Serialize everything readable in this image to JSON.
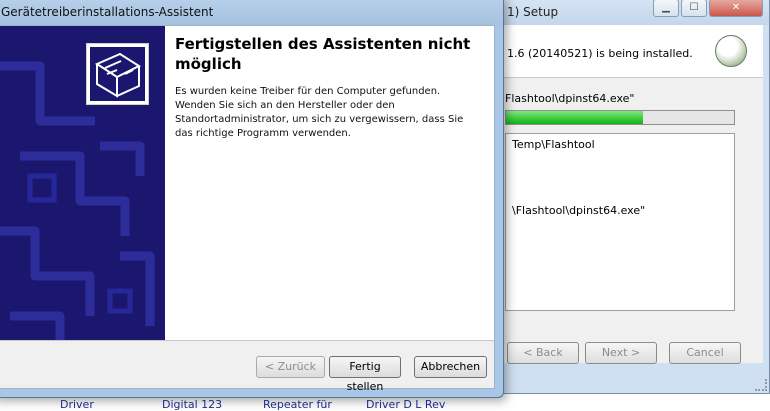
{
  "setup_window": {
    "title": "1) Setup",
    "header_text": "1.6 (20140521) is being installed.",
    "status_text": "Flashtool\\dpinst64.exe\"",
    "progress": 0.6,
    "log_lines": [
      "Temp\\Flashtool",
      "\\Flashtool\\dpinst64.exe\""
    ],
    "buttons": {
      "back": "< Back",
      "next": "Next >",
      "cancel": "Cancel"
    }
  },
  "wizard": {
    "title": "Gerätetreiberinstallations-Assistent",
    "heading": "Fertigstellen des Assistenten nicht möglich",
    "message": "Es wurden keine Treiber für den Computer gefunden. Wenden Sie sich an den Hersteller oder den Standortadministrator, um sich zu vergewissern, dass Sie das richtige Programm verwenden.",
    "buttons": {
      "back": "< Zurück",
      "finish": "Fertig stellen",
      "cancel": "Abbrechen"
    }
  },
  "desktop_labels": [
    "Driver",
    "Digital 123",
    "Repeater für",
    "Driver D L Rev"
  ],
  "colors": {
    "wizard_panel": "#1b176e",
    "progress_fill": "#11b311",
    "window_frame": "#a8c6e6"
  }
}
